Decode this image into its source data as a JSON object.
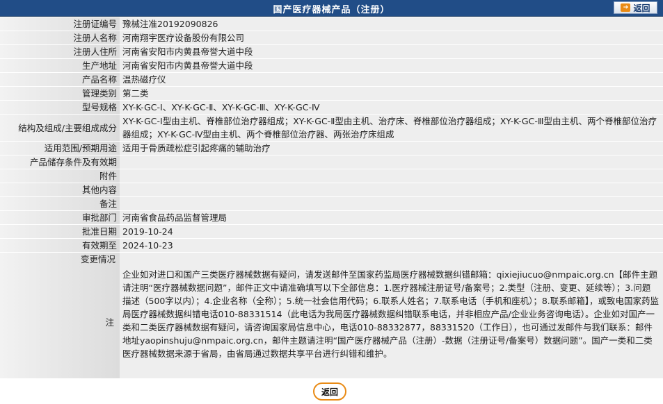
{
  "header": {
    "title": "国产医疗器械产品（注册）",
    "back_label": "返回"
  },
  "rows": [
    {
      "label": "注册证编号",
      "value": "豫械注准20192090826"
    },
    {
      "label": "注册人名称",
      "value": "河南翔宇医疗设备股份有限公司"
    },
    {
      "label": "注册人住所",
      "value": "河南省安阳市内黄县帝誉大道中段"
    },
    {
      "label": "生产地址",
      "value": "河南省安阳市内黄县帝誉大道中段"
    },
    {
      "label": "产品名称",
      "value": "温热磁疗仪"
    },
    {
      "label": "管理类别",
      "value": "第二类"
    },
    {
      "label": "型号规格",
      "value": "XY-K-GC-Ⅰ、XY-K-GC-Ⅱ、XY-K-GC-Ⅲ、XY-K-GC-Ⅳ"
    },
    {
      "label": "结构及组成/主要组成成分",
      "value": "XY-K-GC-Ⅰ型由主机、脊椎部位治疗器组成；XY-K-GC-Ⅱ型由主机、治疗床、脊椎部位治疗器组成；XY-K-GC-Ⅲ型由主机、两个脊椎部位治疗器组成；XY-K-GC-Ⅳ型由主机、两个脊椎部位治疗器、两张治疗床组成"
    },
    {
      "label": "适用范围/预期用途",
      "value": "适用于骨质疏松症引起疼痛的辅助治疗"
    },
    {
      "label": "产品储存条件及有效期",
      "value": ""
    },
    {
      "label": "附件",
      "value": ""
    },
    {
      "label": "其他内容",
      "value": ""
    },
    {
      "label": "备注",
      "value": ""
    },
    {
      "label": "审批部门",
      "value": "河南省食品药品监督管理局"
    },
    {
      "label": "批准日期",
      "value": "2019-10-24"
    },
    {
      "label": "有效期至",
      "value": "2024-10-23"
    }
  ],
  "note": {
    "change_label": "变更情况",
    "label": "注",
    "text": "企业如对进口和国产三类医疗器械数据有疑问，请发送邮件至国家药监局医疗器械数据纠错邮箱：qixiejiucuo@nmpaic.org.cn【邮件主题请注明“医疗器械数据问题”，邮件正文中请准确填写以下全部信息：1.医疗器械注册证号/备案号；2.类型（注册、变更、延续等）；3.问题描述（500字以内）；4.企业名称（全称）；5.统一社会信用代码；6.联系人姓名；7.联系电话（手机和座机）；8.联系邮箱】，或致电国家药监局医疗器械数据纠错电话010-88331514（此电话为我局医疗器械数据纠错联系电话，并非相应产品/企业业务咨询电话）。企业如对国产一类和二类医疗器械数据有疑问，请咨询国家局信息中心，电话010-88332877，88331520（工作日），也可通过发邮件与我们联系：邮件地址yaopinshuju@nmpaic.org.cn，邮件主题请注明“国产医疗器械产品（注册）-数据（注册证号/备案号）数据问题”。国产一类和二类医疗器械数据来源于省局，由省局通过数据共享平台进行纠错和维护。"
  },
  "footer": {
    "back_label": "返回"
  },
  "colors": {
    "header_bg": "#214d87",
    "row_bg": "#eeeeee",
    "accent_orange": "#e98b16"
  }
}
